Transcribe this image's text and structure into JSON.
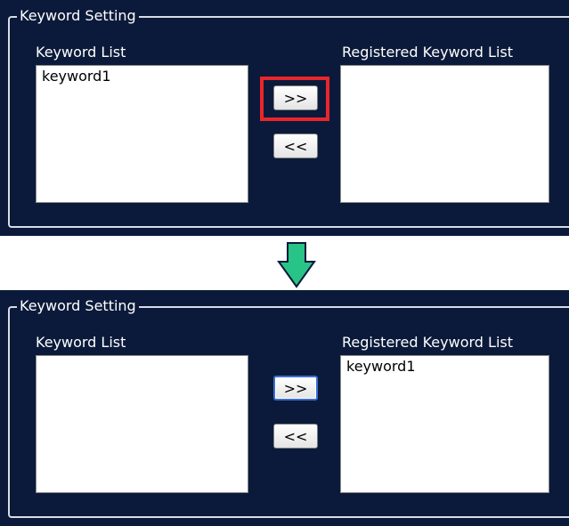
{
  "before": {
    "group_title": "Keyword Setting",
    "keyword_list_label": "Keyword List",
    "registered_list_label": "Registered Keyword List",
    "keyword_list_items": [
      "keyword1"
    ],
    "registered_list_items": [],
    "add_button_label": ">>",
    "remove_button_label": "<<"
  },
  "after": {
    "group_title": "Keyword Setting",
    "keyword_list_label": "Keyword List",
    "registered_list_label": "Registered Keyword List",
    "keyword_list_items": [],
    "registered_list_items": [
      "keyword1"
    ],
    "add_button_label": ">>",
    "remove_button_label": "<<"
  },
  "colors": {
    "panel_background": "#0b1a3a",
    "highlight": "#e8262b",
    "arrow": "#28c487"
  },
  "icons": {
    "transition_arrow": "arrow-down-icon"
  }
}
